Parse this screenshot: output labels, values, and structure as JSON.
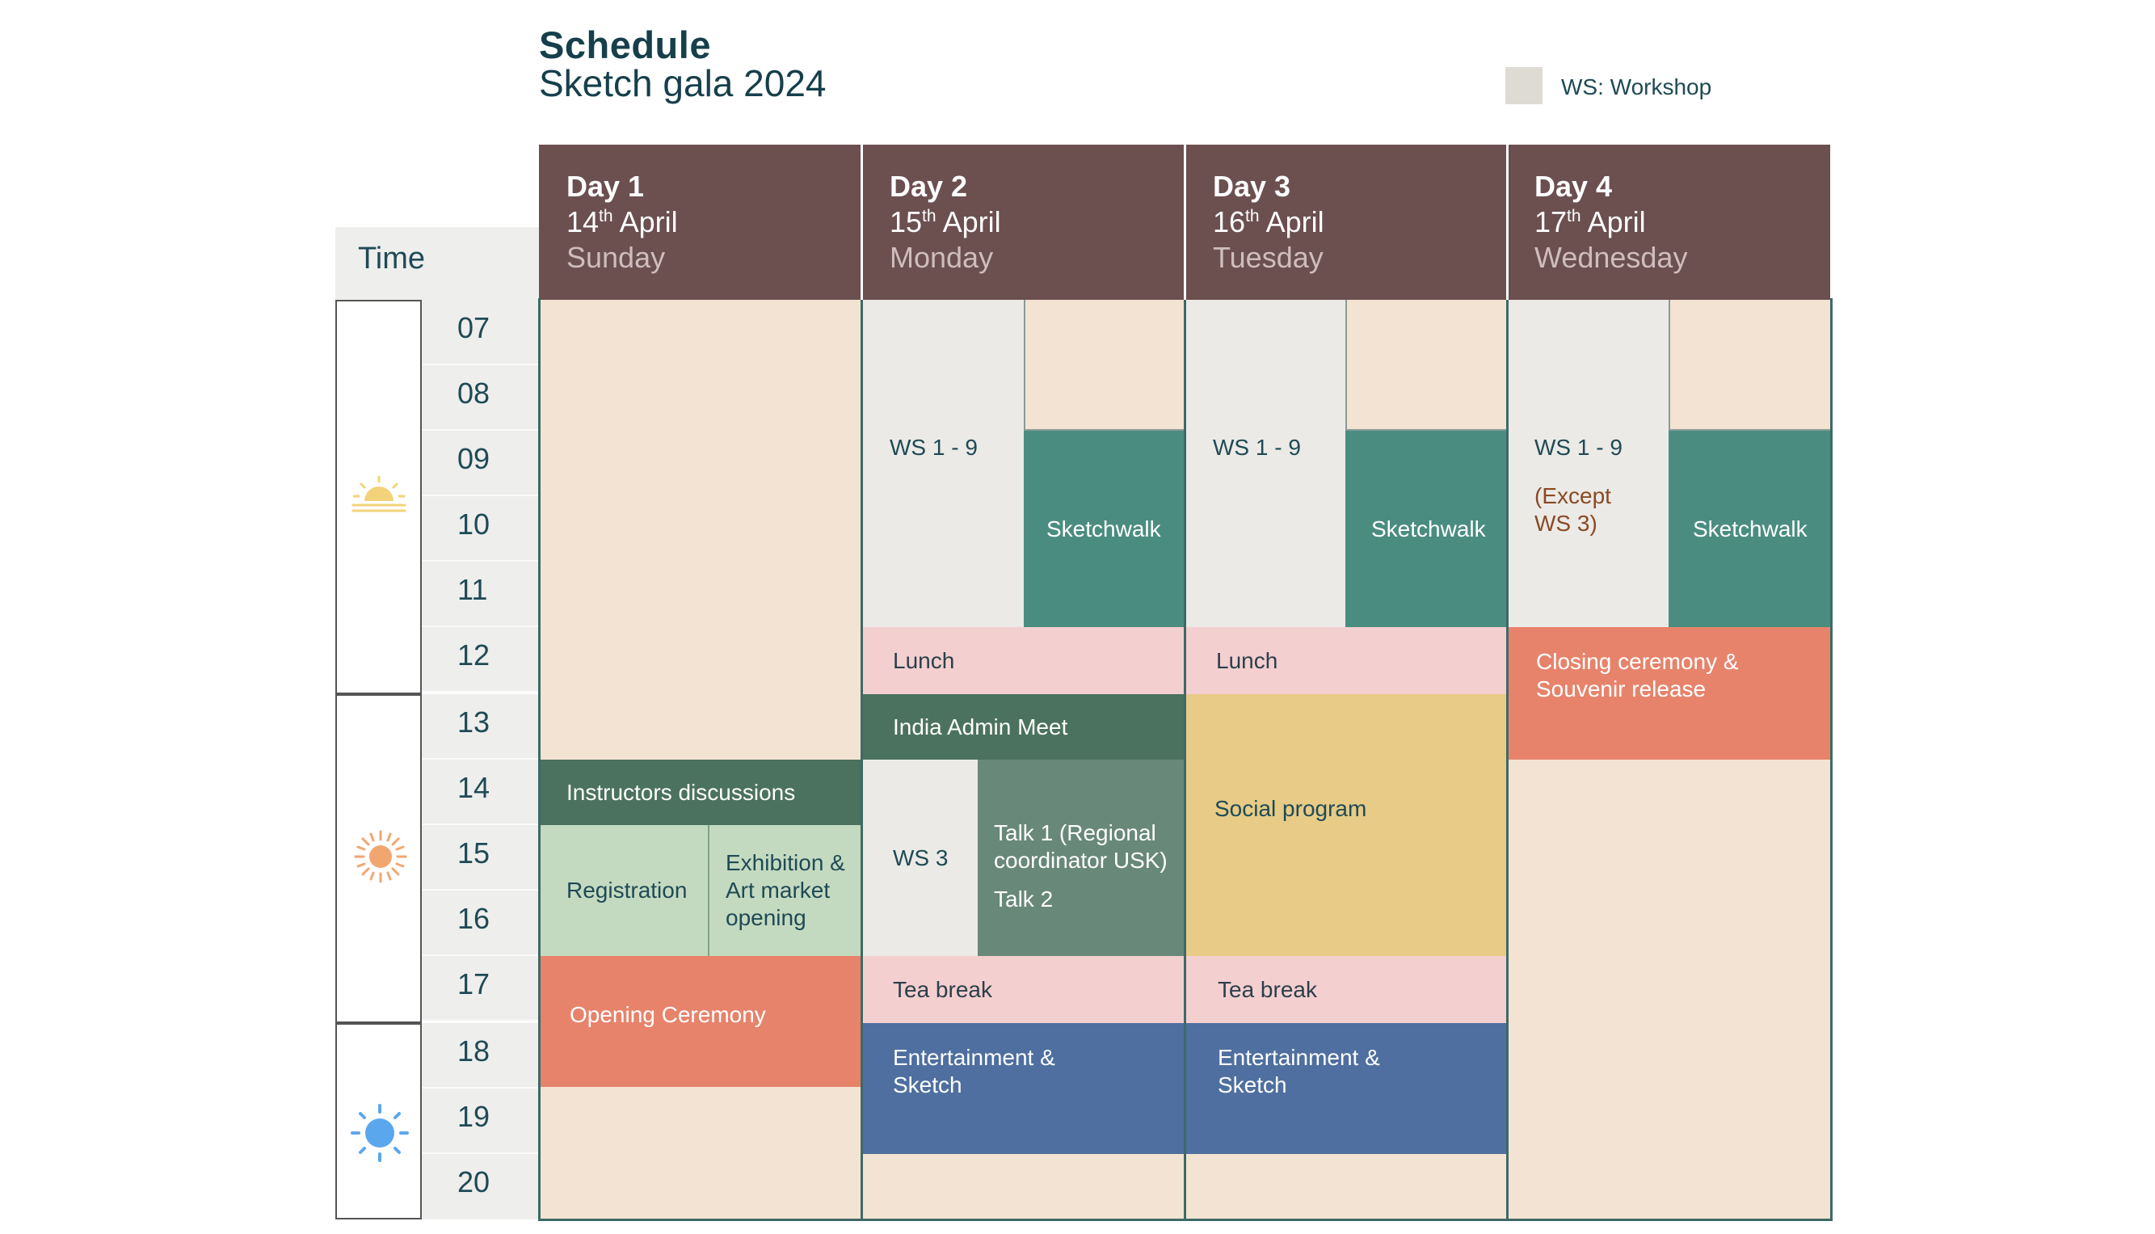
{
  "header": {
    "title": "Schedule",
    "subtitle": "Sketch gala 2024"
  },
  "legend": {
    "label": "WS: Workshop",
    "swatch_color": "#dddbd3"
  },
  "time_label": "Time",
  "days": [
    {
      "name": "Day 1",
      "date_num": "14",
      "date_suffix": "th",
      "month": "April",
      "weekday": "Sunday"
    },
    {
      "name": "Day 2",
      "date_num": "15",
      "date_suffix": "th",
      "month": "April",
      "weekday": "Monday"
    },
    {
      "name": "Day 3",
      "date_num": "16",
      "date_suffix": "th",
      "month": "April",
      "weekday": "Tuesday"
    },
    {
      "name": "Day 4",
      "date_num": "17",
      "date_suffix": "th",
      "month": "April",
      "weekday": "Wednesday"
    }
  ],
  "hours": [
    "07",
    "08",
    "09",
    "10",
    "11",
    "12",
    "13",
    "14",
    "15",
    "16",
    "17",
    "18",
    "19",
    "20"
  ],
  "period_icons": [
    "sunrise-icon",
    "sun-afternoon-icon",
    "sun-evening-icon"
  ],
  "colors": {
    "header_bg": "#6c4f4f",
    "workshop": "#ebeae6",
    "free": "#f3e3d3",
    "sketchwalk": "#4a8d80",
    "meal": "#f4cfd0",
    "meeting": "#4b725e",
    "ceremony": "#e7836b",
    "social": "#e7cb86",
    "entertainment": "#4e6f9f"
  },
  "events": {
    "d1_instructors": "Instructors discussions",
    "d1_registration": "Registration",
    "d1_exhibition": "Exhibition & Art market opening",
    "d1_opening": "Opening Ceremony",
    "d2_ws": "WS 1 - 9",
    "d2_sketchwalk": "Sketchwalk",
    "d2_lunch": "Lunch",
    "d2_admin": "India Admin Meet",
    "d2_ws3": "WS 3",
    "d2_talk1": "Talk 1 (Regional coordinator USK)",
    "d2_talk2": "Talk 2",
    "d2_tea": "Tea break",
    "d2_ent": "Entertainment & Sketch",
    "d3_ws": "WS 1 - 9",
    "d3_sketchwalk": "Sketchwalk",
    "d3_lunch": "Lunch",
    "d3_social": "Social program",
    "d3_tea": "Tea break",
    "d3_ent": "Entertainment & Sketch",
    "d4_ws": "WS 1 - 9",
    "d4_ws_note": "(Except WS 3)",
    "d4_sketchwalk": "Sketchwalk",
    "d4_closing": "Closing ceremony & Souvenir release"
  }
}
